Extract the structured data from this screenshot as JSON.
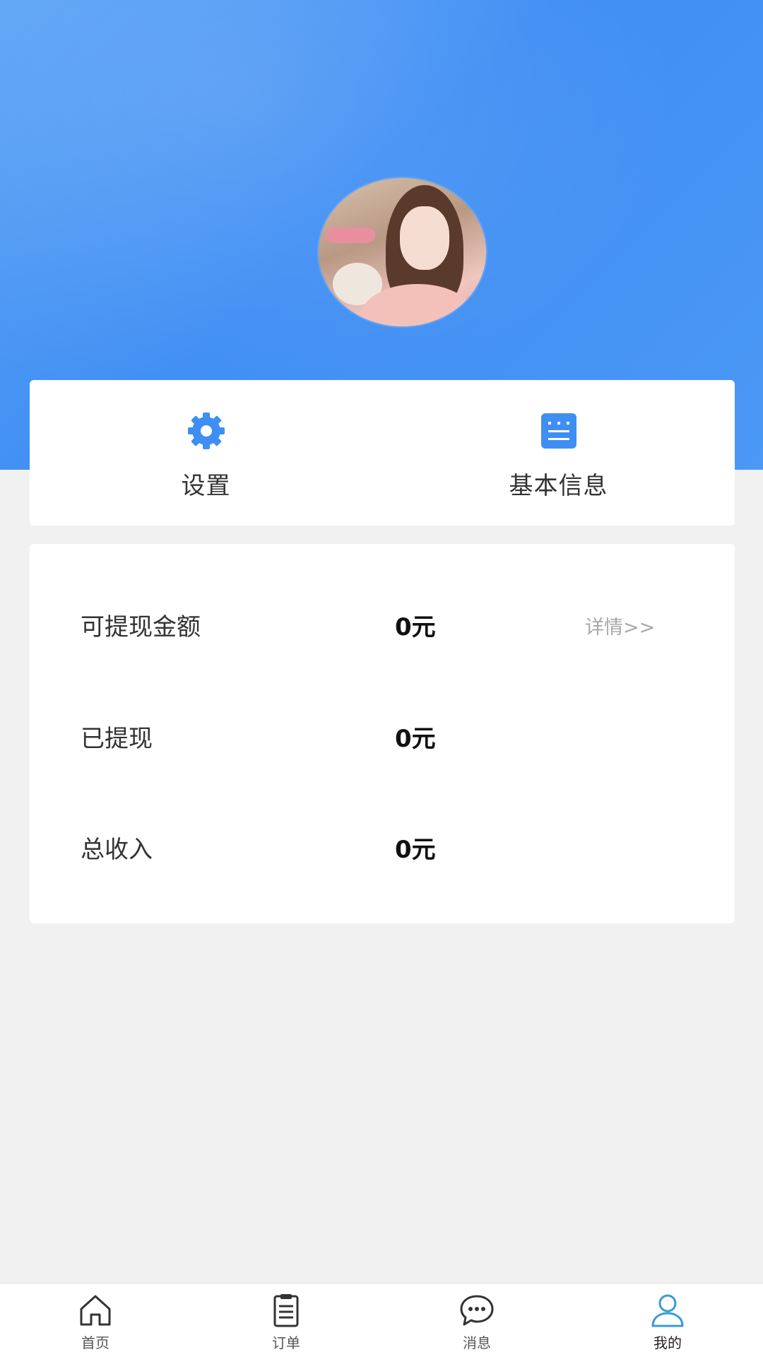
{
  "profile": {
    "avatar_alt": "用户头像"
  },
  "quick_actions": {
    "settings": {
      "label": "设置",
      "icon": "gear-icon"
    },
    "basic_info": {
      "label": "基本信息",
      "icon": "document-icon"
    }
  },
  "stats": [
    {
      "label": "可提现金额",
      "value": "0元",
      "detail": "详情>>"
    },
    {
      "label": "已提现",
      "value": "0元"
    },
    {
      "label": "总收入",
      "value": "0元"
    }
  ],
  "tabbar": {
    "active": "我的",
    "items": [
      {
        "label": "首页",
        "icon": "home-icon"
      },
      {
        "label": "订单",
        "icon": "clipboard-icon"
      },
      {
        "label": "消息",
        "icon": "chat-bubble-icon"
      },
      {
        "label": "我的",
        "icon": "person-icon"
      }
    ]
  },
  "colors": {
    "accent": "#3f8ef4",
    "active_tab": "#3a9bd5"
  }
}
